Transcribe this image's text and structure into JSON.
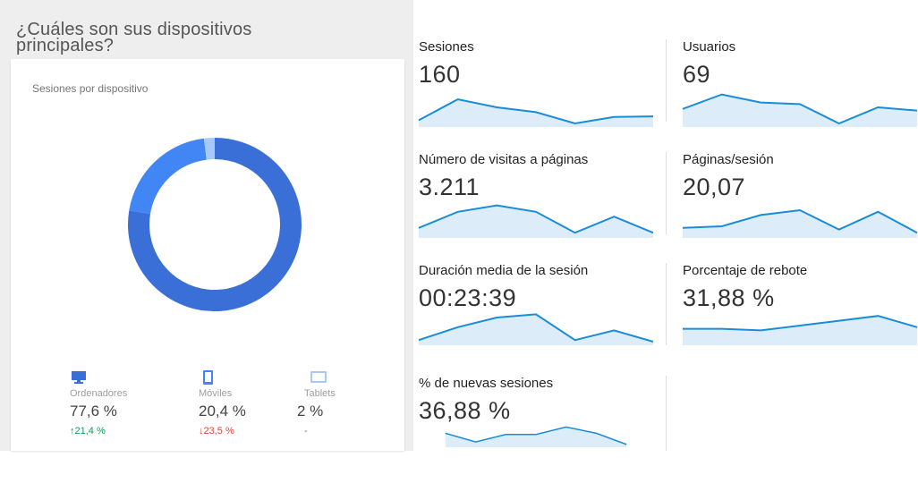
{
  "devices_section": {
    "title": "¿Cuáles son sus dispositivos principales?",
    "card_title": "Sesiones por dispositivo",
    "donut_slices": [
      {
        "name": "Ordenadores",
        "value": 77.6,
        "color": "#3a6fd8"
      },
      {
        "name": "Móviles",
        "value": 20.4,
        "color": "#4285f4"
      },
      {
        "name": "Tablets",
        "value": 2.0,
        "color": "#a8c7fa"
      }
    ],
    "legend": [
      {
        "name": "Ordenadores",
        "icon": "desktop-icon",
        "value": "77,6 %",
        "change": "↑21,4 %",
        "trend": "up",
        "color": "#3a6fd8"
      },
      {
        "name": "Móviles",
        "icon": "mobile-icon",
        "value": "20,4 %",
        "change": "↓23,5 %",
        "trend": "down",
        "color": "#4285f4"
      },
      {
        "name": "Tablets",
        "icon": "tablet-icon",
        "value": "2 %",
        "change": "-",
        "trend": "none",
        "color": "#a8c7fa"
      }
    ]
  },
  "metrics": [
    {
      "id": "sesiones",
      "label": "Sesiones",
      "value": "160",
      "spark": [
        0.1,
        0.75,
        0.5,
        0.35,
        0.0,
        0.2,
        0.22
      ]
    },
    {
      "id": "usuarios",
      "label": "Usuarios",
      "value": "69",
      "spark": [
        0.45,
        0.9,
        0.65,
        0.6,
        0.0,
        0.5,
        0.4
      ]
    },
    {
      "id": "visitas-paginas",
      "label": "Número de visitas a páginas",
      "value": "3.211",
      "spark": [
        0.2,
        0.7,
        0.9,
        0.7,
        0.05,
        0.55,
        0.05
      ]
    },
    {
      "id": "paginas-sesion",
      "label": "Páginas/sesión",
      "value": "20,07",
      "spark": [
        0.2,
        0.25,
        0.6,
        0.75,
        0.15,
        0.7,
        0.05
      ]
    },
    {
      "id": "duracion-media",
      "label": "Duración media de la sesión",
      "value": "00:23:39",
      "spark": [
        0.05,
        0.45,
        0.75,
        0.85,
        0.05,
        0.35,
        0.0
      ]
    },
    {
      "id": "porcentaje-rebote",
      "label": "Porcentaje de rebote",
      "value": "31,88 %",
      "spark": [
        0.4,
        0.4,
        0.35,
        0.5,
        0.65,
        0.8,
        0.45
      ]
    },
    {
      "id": "nuevas-sesiones",
      "label": "% de nuevas sesiones",
      "value": "36,88 %",
      "spark": [
        0.45,
        0.1,
        0.4,
        0.4,
        0.7,
        0.45,
        0.0
      ]
    }
  ],
  "colors": {
    "spark_line": "#1a8cd8",
    "spark_fill": "#dcedf9",
    "up": "#0f9d58",
    "down": "#db4437"
  }
}
